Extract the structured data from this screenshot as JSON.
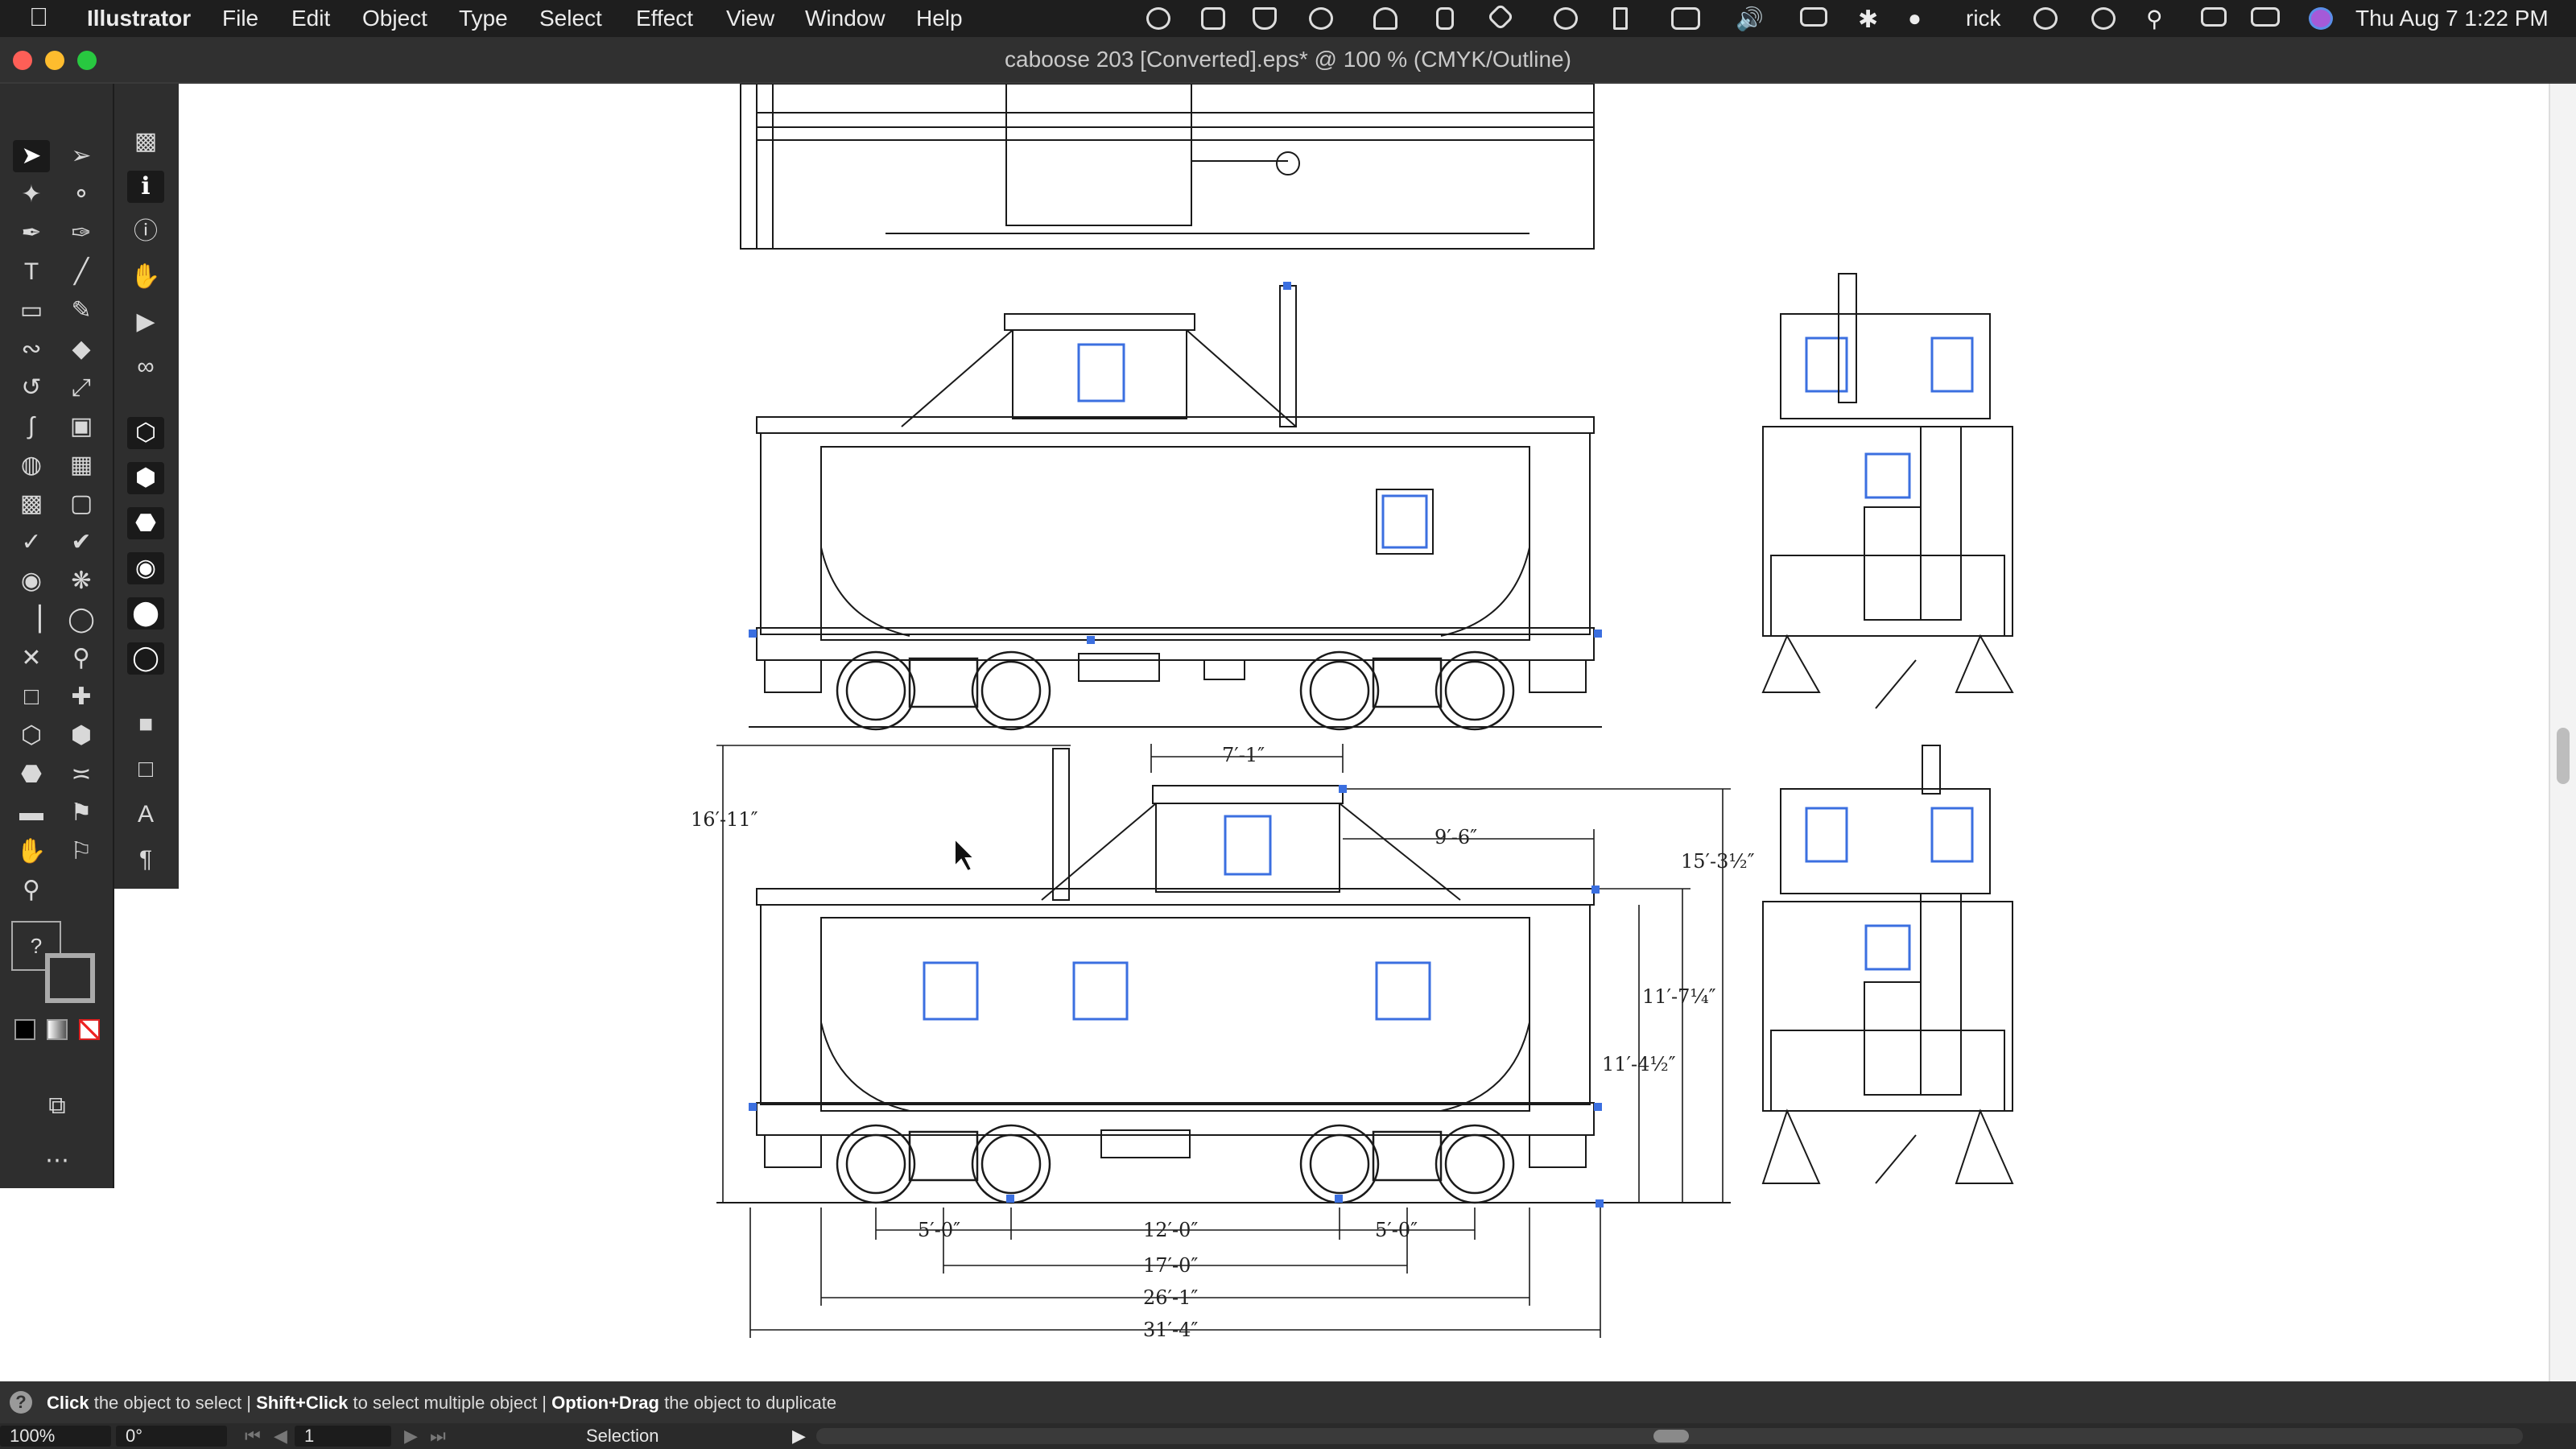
{
  "menubar": {
    "app_name": "Illustrator",
    "menus": [
      "File",
      "Edit",
      "Object",
      "Type",
      "Select",
      "Effect",
      "View",
      "Window",
      "Help"
    ],
    "user": "rick",
    "datetime": "Thu Aug 7  1:22 PM"
  },
  "window": {
    "title": "caboose 203 [Converted].eps* @ 100 % (CMYK/Outline)"
  },
  "drawing": {
    "dimensions": {
      "cupola_width": "7′-1″",
      "cupola_offset": "9′-6″",
      "overall_height_left": "16′-11″",
      "overall_height_right": "15′-3½″",
      "height_a": "11′-7¼″",
      "height_b": "11′-4½″",
      "truck_a": "5′-0″",
      "center": "12′-0″",
      "truck_b": "5′-0″",
      "truck_centers": "17′-0″",
      "body_length": "26′-1″",
      "overall_length": "31′-4″"
    }
  },
  "status": {
    "hint_parts": [
      "Click",
      " the object to select  |  ",
      "Shift+Click",
      " to select multiple object  |  ",
      "Option+Drag",
      " the object to duplicate"
    ],
    "zoom": "100%",
    "rotation": "0°",
    "artboard": "1",
    "tool_name": "Selection"
  },
  "colors": {
    "menubar": "#1e1e1e",
    "panel": "#2e2e2e",
    "selection_anchor": "#3b6fe0"
  }
}
